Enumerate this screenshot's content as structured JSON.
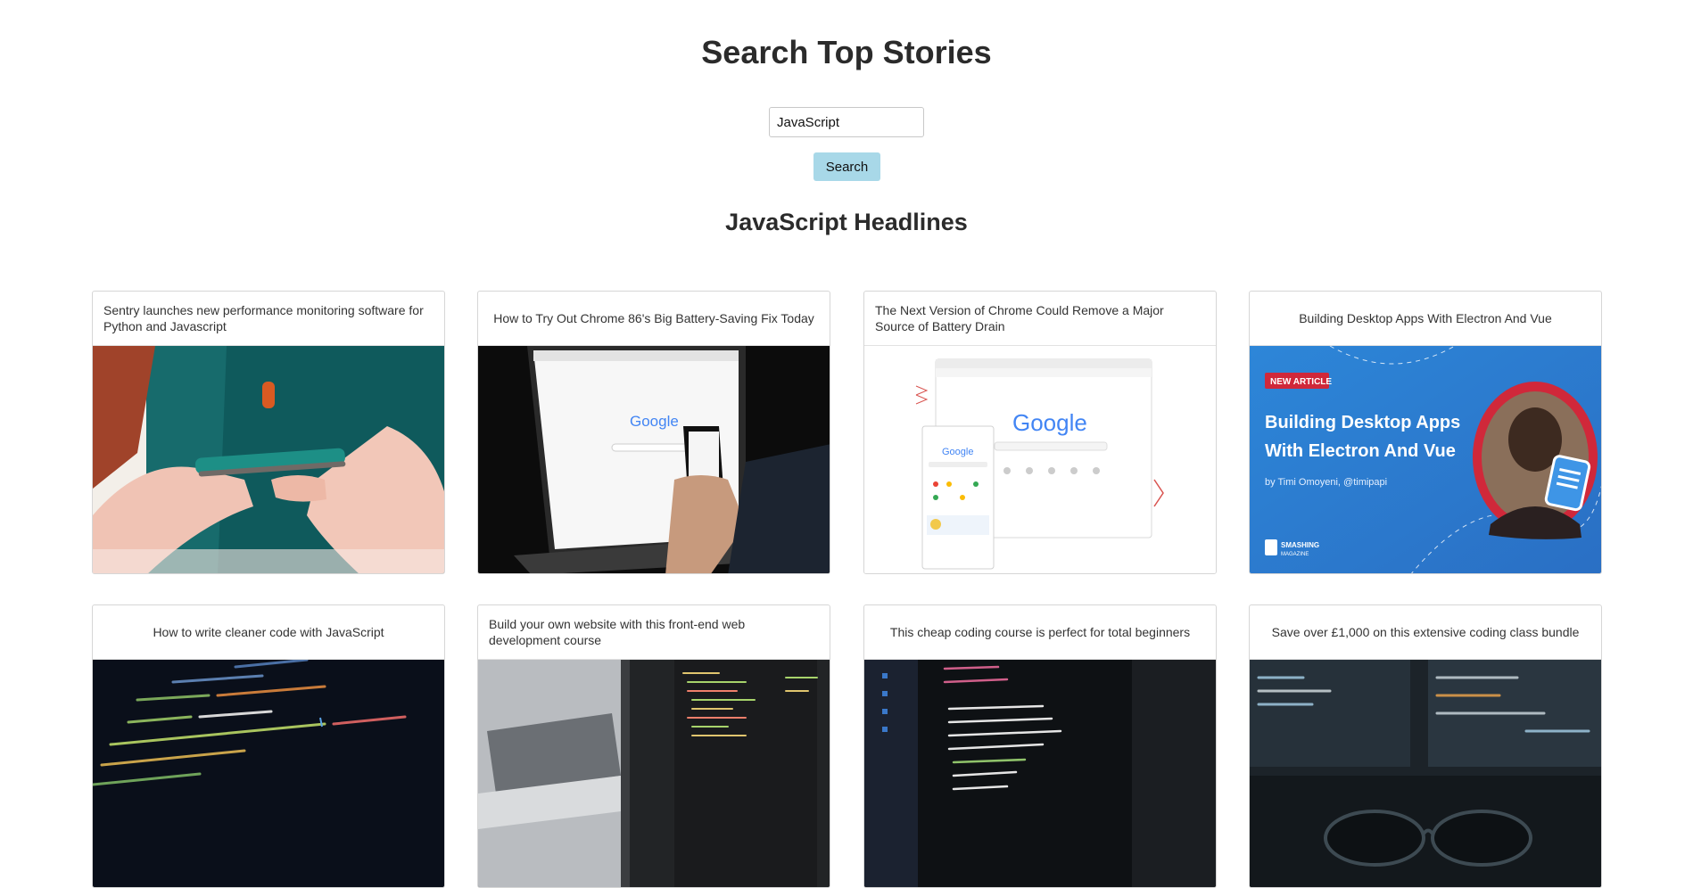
{
  "page": {
    "title": "Search Top Stories"
  },
  "search": {
    "value": "JavaScript",
    "button_label": "Search"
  },
  "results": {
    "heading": "JavaScript Headlines"
  },
  "articles": [
    {
      "title": "Sentry launches new performance monitoring software for Python and Javascript",
      "image": "phone-hands"
    },
    {
      "title": "How to Try Out Chrome 86's Big Battery-Saving Fix Today",
      "image": "laptop-google"
    },
    {
      "title": "The Next Version of Chrome Could Remove a Major Source of Battery Drain",
      "image": "chrome-windows"
    },
    {
      "title": "Building Desktop Apps With Electron And Vue",
      "image": "smashing-banner",
      "banner": {
        "badge": "NEW ARTICLE",
        "headline_line1": "Building Desktop Apps",
        "headline_line2": "With Electron And Vue",
        "byline": "by Timi Omoyeni, @timipapi",
        "brand_line1": "SMASHING",
        "brand_line2": "MAGAZINE"
      }
    },
    {
      "title": "How to write cleaner code with JavaScript",
      "image": "code-dark"
    },
    {
      "title": "Build your own website with this front-end web development course",
      "image": "code-laptop-blur"
    },
    {
      "title": "This cheap coding course is perfect for total beginners",
      "image": "code-screen"
    },
    {
      "title": "Save over £1,000 on this extensive coding class bundle",
      "image": "monitors-glasses"
    }
  ],
  "image_text": {
    "google": "Google"
  },
  "colors": {
    "button": "#a8d8e8",
    "banner_blue": "#2f86d6",
    "badge_red": "#d0283a"
  }
}
